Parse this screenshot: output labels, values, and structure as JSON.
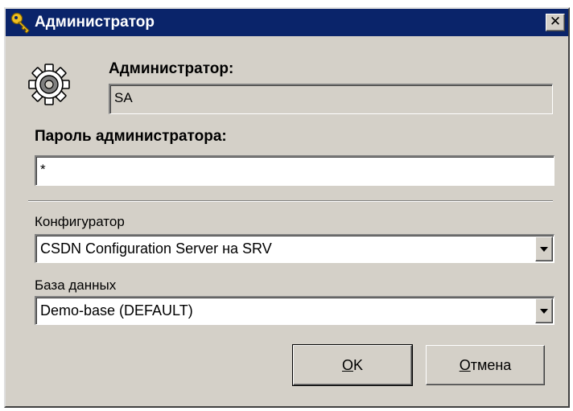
{
  "window": {
    "title": "Администратор",
    "close_glyph": "✕"
  },
  "admin": {
    "label": "Администратор:",
    "value": "SA"
  },
  "password": {
    "label": "Пароль администратора:",
    "value": "*"
  },
  "configurator": {
    "label": "Конфигуратор",
    "selected": "CSDN Configuration Server на SRV"
  },
  "database": {
    "label": "База данных",
    "selected": "Demo-base (DEFAULT)"
  },
  "buttons": {
    "ok_first": "О",
    "ok_rest": "K",
    "cancel_first": "О",
    "cancel_rest": "тмена"
  },
  "icons": {
    "title": "key-icon",
    "dialog": "gear-icon"
  },
  "colors": {
    "titlebar": "#0a246a",
    "face": "#d4d0c8"
  }
}
